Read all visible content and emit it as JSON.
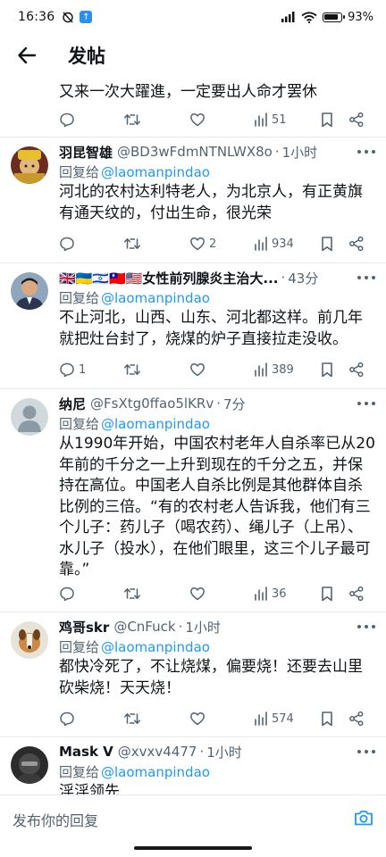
{
  "status_bar": {
    "time": "16:36",
    "battery": "93%"
  },
  "header": {
    "title": "发帖"
  },
  "partial_tweet": {
    "text": "又来一次大躍進，一定要出人命才罢休",
    "views": "51"
  },
  "tweets": [
    {
      "display_name": "羽昆智雄",
      "handle": "@BD3wFdmNTNLWX8o",
      "time": "1小时",
      "reply_prefix": "回复给",
      "reply_to": "@laomanpindao",
      "text": "河北的农村达利特老人，为北京人，有正黄旗有通天纹的，付出生命，很光荣",
      "replies": "",
      "retweets": "",
      "likes": "2",
      "views": "934"
    },
    {
      "display_name": "🇬🇧🇺🇦🇮🇱🇹🇼🇺🇸女性前列腺炎主治大...",
      "handle": "",
      "time": "43分",
      "reply_prefix": "回复给",
      "reply_to": "@laomanpindao",
      "text": "不止河北，山西、山东、河北都这样。前几年就把灶台封了，烧煤的炉子直接拉走没收。",
      "replies": "1",
      "retweets": "",
      "likes": "",
      "views": "389"
    },
    {
      "display_name": "纳尼",
      "handle": "@FsXtg0ffao5lKRv",
      "time": "7分",
      "reply_prefix": "回复给",
      "reply_to": "@laomanpindao",
      "text": "从1990年开始，中国农村老年人自杀率已从20年前的千分之一上升到现在的千分之五，并保持在高位。中国老人自杀比例是其他群体自杀比例的三倍。“有的农村老人告诉我，他们有三个儿子：药儿子（喝农药）、绳儿子（上吊）、水儿子（投水），在他们眼里，这三个儿子最可靠。”",
      "replies": "",
      "retweets": "",
      "likes": "",
      "views": "36"
    },
    {
      "display_name": "鸡哥skr",
      "handle": "@CnFuck",
      "time": "1小时",
      "reply_prefix": "回复给",
      "reply_to": "@laomanpindao",
      "text": "都快冷死了，不让烧煤，偏要烧！还要去山里砍柴烧！天天烧！",
      "replies": "",
      "retweets": "",
      "likes": "",
      "views": "574"
    },
    {
      "display_name": "Mask V",
      "handle": "@xvxv4477",
      "time": "1小时",
      "reply_prefix": "回复给",
      "reply_to": "@laomanpindao",
      "text": "淫淫领先",
      "replies": "",
      "retweets": "",
      "likes": "",
      "views": ""
    }
  ],
  "reply_bar": {
    "placeholder": "发布你的回复"
  },
  "colors": {
    "link": "#1d9bf0",
    "secondary_text": "#536471",
    "divider": "#e6e9ec"
  }
}
